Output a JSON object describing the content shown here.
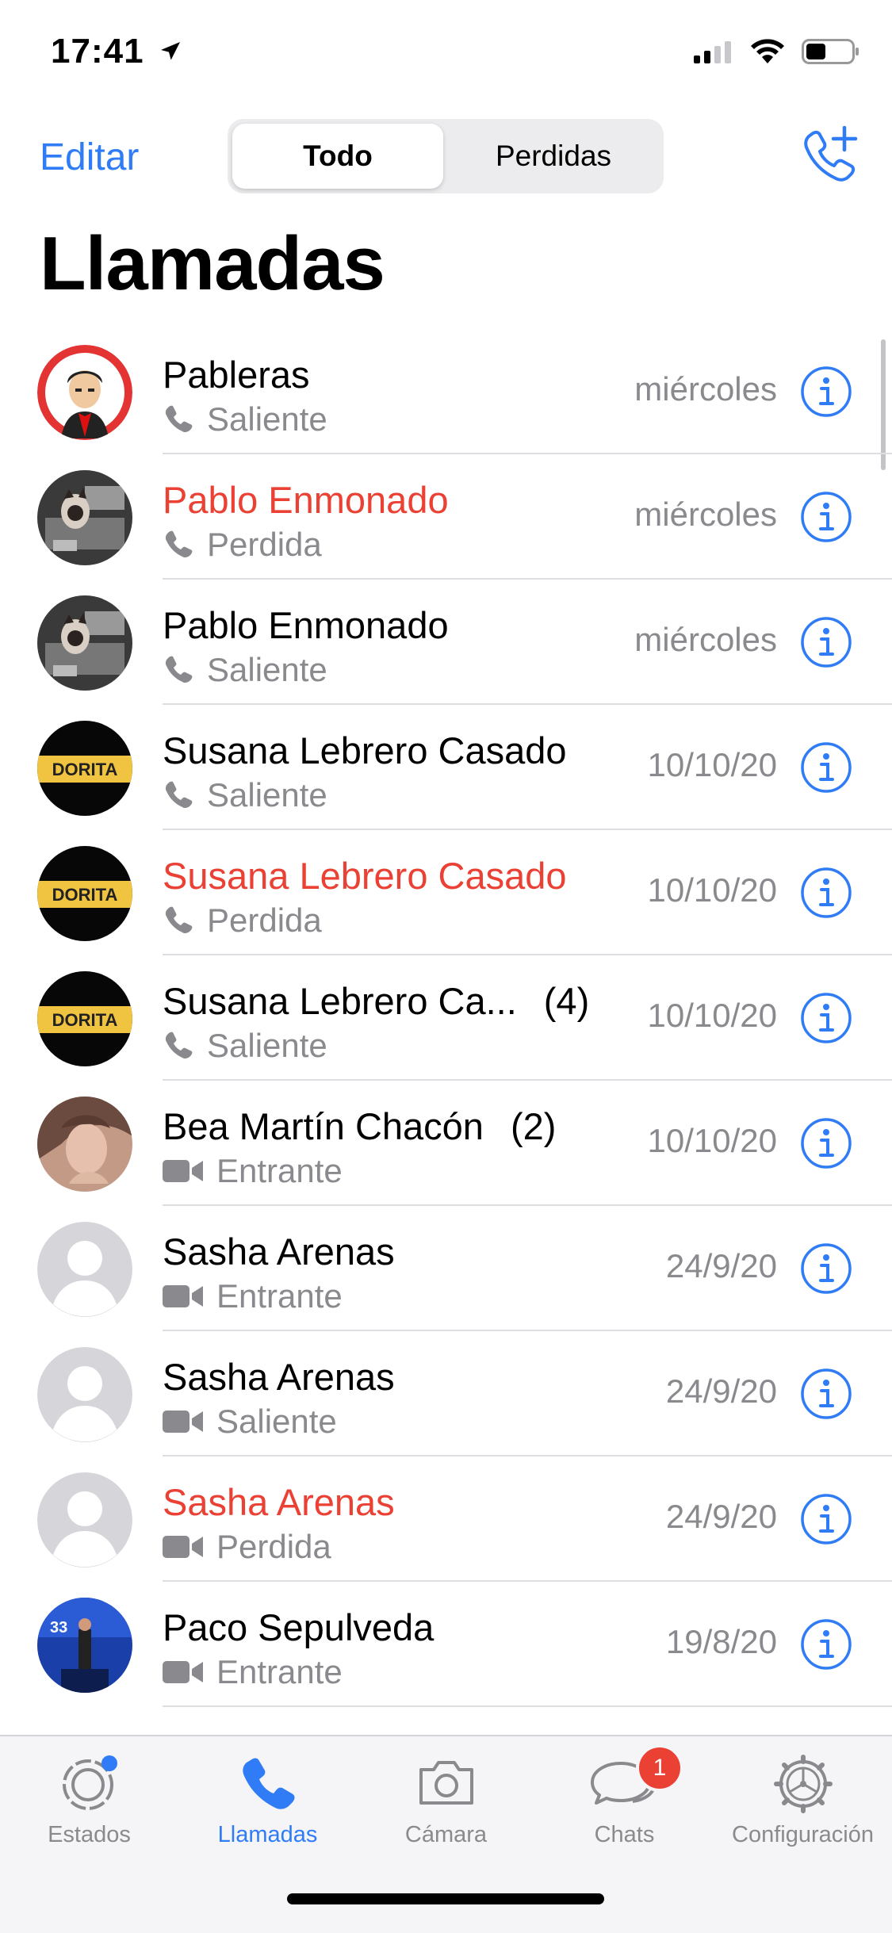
{
  "status_bar": {
    "time": "17:41"
  },
  "header": {
    "edit_label": "Editar",
    "segments": [
      "Todo",
      "Perdidas"
    ],
    "selected_segment": "Todo"
  },
  "title": "Llamadas",
  "calls": [
    {
      "name": "Pableras",
      "count": "",
      "status": "Saliente",
      "type": "voice",
      "missed": false,
      "date": "miércoles",
      "avatar": "cartoon"
    },
    {
      "name": "Pablo Enmonado",
      "count": "",
      "status": "Perdida",
      "type": "voice",
      "missed": true,
      "date": "miércoles",
      "avatar": "cat"
    },
    {
      "name": "Pablo Enmonado",
      "count": "",
      "status": "Saliente",
      "type": "voice",
      "missed": false,
      "date": "miércoles",
      "avatar": "cat"
    },
    {
      "name": "Susana Lebrero Casado",
      "count": "",
      "status": "Saliente",
      "type": "voice",
      "missed": false,
      "date": "10/10/20",
      "avatar": "sign"
    },
    {
      "name": "Susana Lebrero Casado",
      "count": "",
      "status": "Perdida",
      "type": "voice",
      "missed": true,
      "date": "10/10/20",
      "avatar": "sign"
    },
    {
      "name": "Susana Lebrero Ca...",
      "count": "(4)",
      "status": "Saliente",
      "type": "voice",
      "missed": false,
      "date": "10/10/20",
      "avatar": "sign"
    },
    {
      "name": "Bea Martín Chacón",
      "count": "(2)",
      "status": "Entrante",
      "type": "video",
      "missed": false,
      "date": "10/10/20",
      "avatar": "photo"
    },
    {
      "name": "Sasha Arenas",
      "count": "",
      "status": "Entrante",
      "type": "video",
      "missed": false,
      "date": "24/9/20",
      "avatar": "placeholder"
    },
    {
      "name": "Sasha Arenas",
      "count": "",
      "status": "Saliente",
      "type": "video",
      "missed": false,
      "date": "24/9/20",
      "avatar": "placeholder"
    },
    {
      "name": "Sasha Arenas",
      "count": "",
      "status": "Perdida",
      "type": "video",
      "missed": true,
      "date": "24/9/20",
      "avatar": "placeholder"
    },
    {
      "name": "Paco Sepulveda",
      "count": "",
      "status": "Entrante",
      "type": "video",
      "missed": false,
      "date": "19/8/20",
      "avatar": "stage"
    }
  ],
  "tabs": [
    {
      "label": "Estados",
      "icon": "status-icon",
      "active": false
    },
    {
      "label": "Llamadas",
      "icon": "phone-icon",
      "active": true
    },
    {
      "label": "Cámara",
      "icon": "camera-icon",
      "active": false
    },
    {
      "label": "Chats",
      "icon": "chats-icon",
      "active": false,
      "badge": "1"
    },
    {
      "label": "Configuración",
      "icon": "settings-icon",
      "active": false
    }
  ],
  "colors": {
    "accent": "#2f7cf6",
    "missed": "#eb4135",
    "secondary": "#8a8a8e"
  }
}
